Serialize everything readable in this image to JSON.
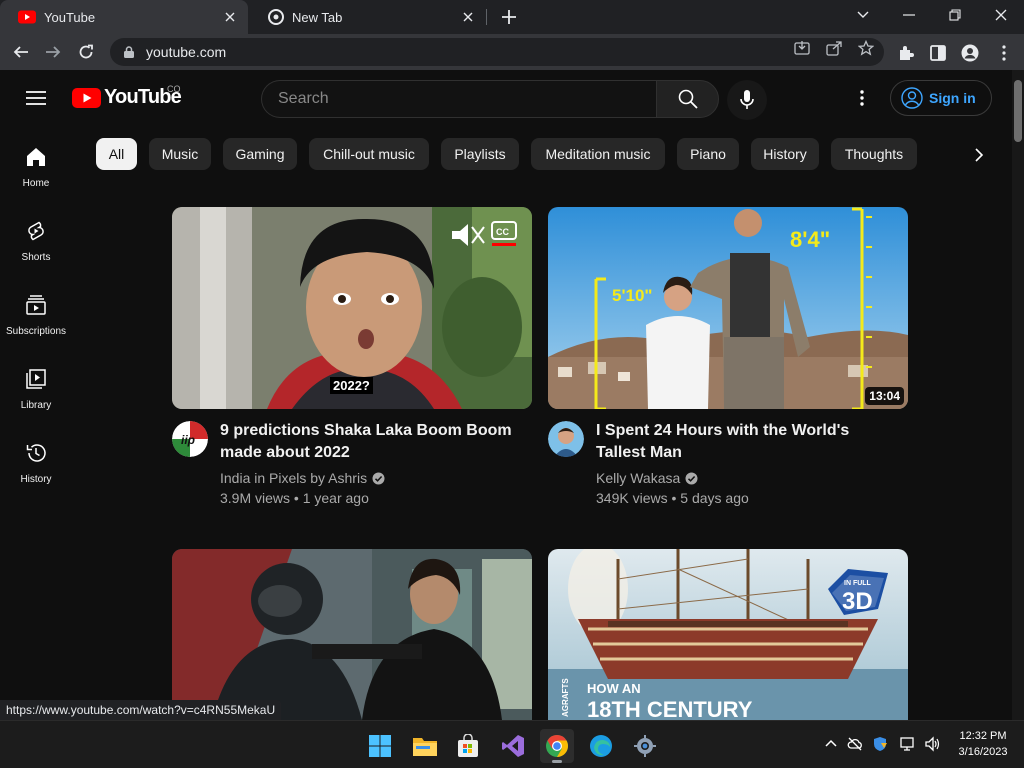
{
  "browser": {
    "tabs": [
      {
        "title": "YouTube",
        "active": true
      },
      {
        "title": "New Tab",
        "active": false
      }
    ],
    "address": "youtube.com",
    "status_url": "https://www.youtube.com/watch?v=c4RN55MekaU"
  },
  "header": {
    "logo_text": "YouTube",
    "country_code": "CO",
    "search_placeholder": "Search",
    "sign_in": "Sign in"
  },
  "sidebar": {
    "items": [
      {
        "label": "Home",
        "icon": "home-icon"
      },
      {
        "label": "Shorts",
        "icon": "shorts-icon"
      },
      {
        "label": "Subscriptions",
        "icon": "subscriptions-icon"
      },
      {
        "label": "Library",
        "icon": "library-icon"
      },
      {
        "label": "History",
        "icon": "history-icon"
      }
    ]
  },
  "chips": [
    "All",
    "Music",
    "Gaming",
    "Chill-out music",
    "Playlists",
    "Meditation music",
    "Piano",
    "History",
    "Thoughts"
  ],
  "videos": [
    {
      "title": "9 predictions Shaka Laka Boom Boom made about 2022",
      "channel": "India in Pixels by Ashris",
      "views": "3.9M views",
      "age": "1 year ago",
      "overlay_text": "2022?",
      "avatar_text": "iip"
    },
    {
      "title": "I Spent 24 Hours with the World's Tallest Man",
      "channel": "Kelly Wakasa",
      "views": "349K views",
      "age": "5 days ago",
      "duration": "13:04",
      "height_a": "5'10\"",
      "height_b": "8'4\""
    },
    {
      "overlay_text": ""
    },
    {
      "overlay_line1": "HOW AN",
      "overlay_line2": "18TH CENTURY",
      "badge_top": "IN FULL",
      "badge_main": "3D",
      "side_text": "AGRAFTS"
    }
  ],
  "taskbar": {
    "time": "12:32 PM",
    "date": "3/16/2023"
  },
  "colors": {
    "background": "#0f0f0f",
    "youtube_red": "#ff0000",
    "link_blue": "#3ea6ff",
    "chip_bg": "#272727"
  }
}
